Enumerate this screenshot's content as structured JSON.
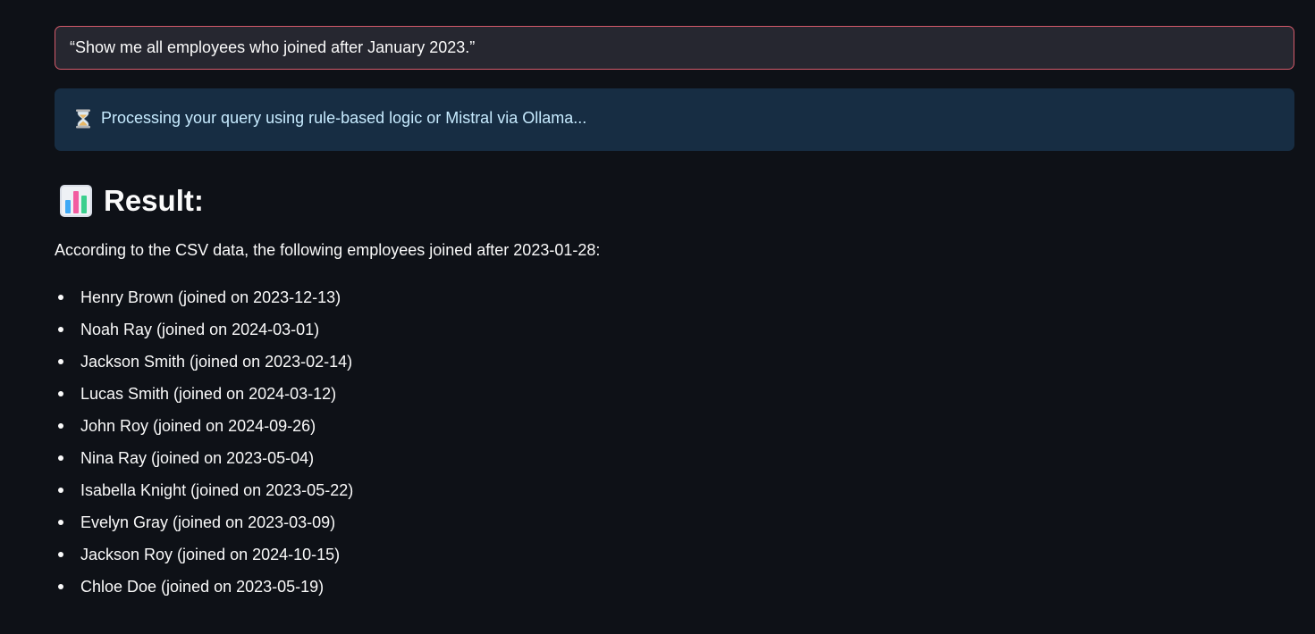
{
  "query": {
    "text": "“Show me all employees who joined after January 2023.”"
  },
  "info": {
    "icon": "hourglass-icon",
    "text": "Processing your query using rule-based logic or Mistral via Ollama..."
  },
  "result": {
    "icon": "bar-chart-icon",
    "title": "Result:",
    "summary": "According to the CSV data, the following employees joined after 2023-01-28:",
    "employees": [
      "Henry Brown (joined on 2023-12-13)",
      "Noah Ray (joined on 2024-03-01)",
      "Jackson Smith (joined on 2023-02-14)",
      "Lucas Smith (joined on 2024-03-12)",
      "John Roy (joined on 2024-09-26)",
      "Nina Ray (joined on 2023-05-04)",
      "Isabella Knight (joined on 2023-05-22)",
      "Evelyn Gray (joined on 2023-03-09)",
      "Jackson Roy (joined on 2024-10-15)",
      "Chloe Doe (joined on 2023-05-19)"
    ]
  },
  "colors": {
    "background": "#0e1117",
    "query_border": "#d45a6a",
    "query_background": "#262730",
    "info_background": "#172d43",
    "info_text": "#c7ebff"
  }
}
